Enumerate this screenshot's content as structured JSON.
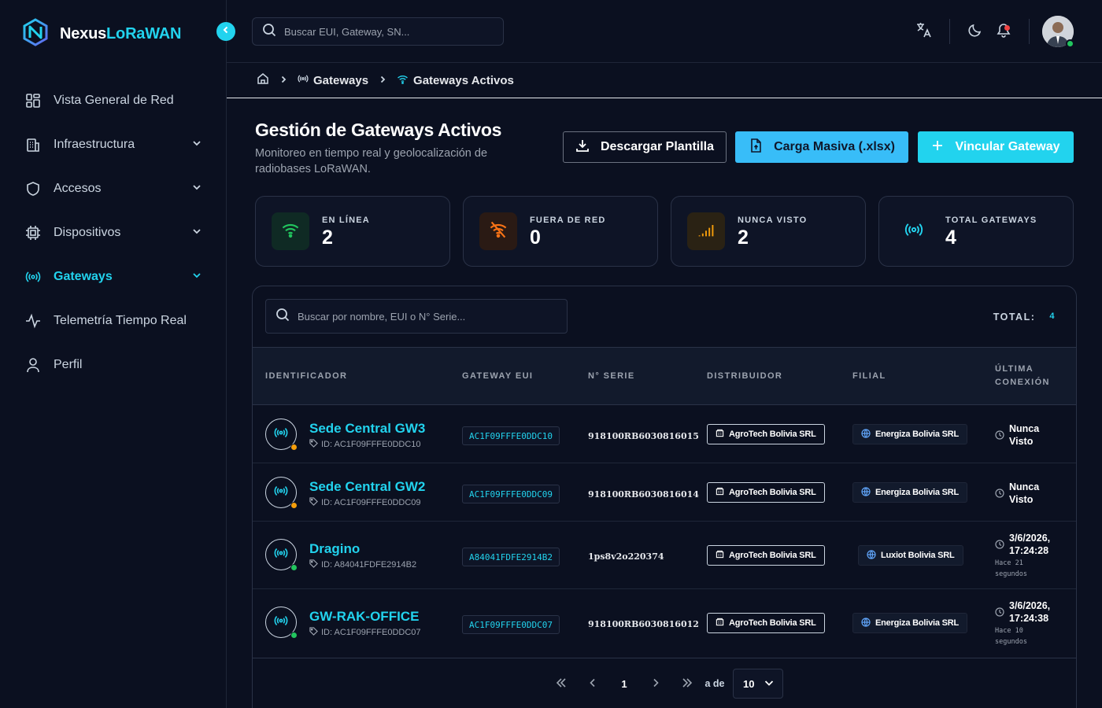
{
  "brand": {
    "name_part1": "Nexus",
    "name_part2": "LoRaWAN"
  },
  "sidebar": {
    "items": [
      {
        "label": "Vista General de Red",
        "icon": "grid-icon",
        "has_chevron": false,
        "active": false
      },
      {
        "label": "Infraestructura",
        "icon": "building-icon",
        "has_chevron": true,
        "active": false
      },
      {
        "label": "Accesos",
        "icon": "shield-icon",
        "has_chevron": true,
        "active": false
      },
      {
        "label": "Dispositivos",
        "icon": "chip-icon",
        "has_chevron": true,
        "active": false
      },
      {
        "label": "Gateways",
        "icon": "radio-icon",
        "has_chevron": true,
        "active": true
      },
      {
        "label": "Telemetría Tiempo Real",
        "icon": "activity-icon",
        "has_chevron": false,
        "active": false
      },
      {
        "label": "Perfil",
        "icon": "user-icon",
        "has_chevron": false,
        "active": false
      }
    ]
  },
  "topbar": {
    "search_placeholder": "Buscar EUI, Gateway, SN..."
  },
  "breadcrumb": {
    "level1": "Gateways",
    "level2": "Gateways Activos"
  },
  "page": {
    "title": "Gestión de Gateways Activos",
    "subtitle": "Monitoreo en tiempo real y geolocalización de radiobases LoRaWAN."
  },
  "actions": {
    "download": "Descargar Plantilla",
    "bulk_upload": "Carga Masiva (.xlsx)",
    "link_gateway": "Vincular Gateway"
  },
  "stats": [
    {
      "label": "EN LÍNEA",
      "value": "2",
      "icon": "wifi-icon",
      "color": "#22c55e",
      "bg": "#0f2a24"
    },
    {
      "label": "FUERA DE RED",
      "value": "0",
      "icon": "wifi-off-icon",
      "color": "#f97316",
      "bg": "#2a1a14"
    },
    {
      "label": "NUNCA VISTO",
      "value": "2",
      "icon": "signal-icon",
      "color": "#f59e0b",
      "bg": "#2a2214"
    },
    {
      "label": "TOTAL GATEWAYS",
      "value": "4",
      "icon": "radio-icon",
      "color": "#22d3ee",
      "bg": "#0e1426"
    }
  ],
  "table": {
    "search_placeholder": "Buscar por nombre, EUI o N° Serie...",
    "total_label": "TOTAL:",
    "total_value": "4",
    "headers": {
      "identificador": "IDENTIFICADOR",
      "eui": "GATEWAY EUI",
      "serie": "N° SERIE",
      "distribuidor": "DISTRIBUIDOR",
      "filial": "FILIAL",
      "ultima_1": "ÚLTIMA",
      "ultima_2": "CONEXIÓN"
    },
    "rows": [
      {
        "name": "Sede Central GW3",
        "id": "ID: AC1F09FFFE0DDC10",
        "eui": "AC1F09FFFE0DDC10",
        "serial": "918100RB6030816015",
        "distributor": "AgroTech Bolivia SRL",
        "filial": "Energiza Bolivia SRL",
        "last_1": "Nunca",
        "last_2": "Visto",
        "last_sub_1": "",
        "last_sub_2": "",
        "status_color": "#f59e0b"
      },
      {
        "name": "Sede Central GW2",
        "id": "ID: AC1F09FFFE0DDC09",
        "eui": "AC1F09FFFE0DDC09",
        "serial": "918100RB6030816014",
        "distributor": "AgroTech Bolivia SRL",
        "filial": "Energiza Bolivia SRL",
        "last_1": "Nunca",
        "last_2": "Visto",
        "last_sub_1": "",
        "last_sub_2": "",
        "status_color": "#f59e0b"
      },
      {
        "name": "Dragino",
        "id": "ID: A84041FDFE2914B2",
        "eui": "A84041FDFE2914B2",
        "serial": "1ps8v2o220374",
        "distributor": "AgroTech Bolivia SRL",
        "filial": "Luxiot Bolivia SRL",
        "last_1": "3/6/2026,",
        "last_2": "17:24:28",
        "last_sub_1": "Hace 21",
        "last_sub_2": "segundos",
        "status_color": "#22c55e"
      },
      {
        "name": "GW-RAK-OFFICE",
        "id": "ID: AC1F09FFFE0DDC07",
        "eui": "AC1F09FFFE0DDC07",
        "serial": "918100RB6030816012",
        "distributor": "AgroTech Bolivia SRL",
        "filial": "Energiza Bolivia SRL",
        "last_1": "3/6/2026,",
        "last_2": "17:24:38",
        "last_sub_1": "Hace 10",
        "last_sub_2": "segundos",
        "status_color": "#22c55e"
      }
    ]
  },
  "pagination": {
    "page": "1",
    "of_label": "a de",
    "page_size": "10"
  }
}
